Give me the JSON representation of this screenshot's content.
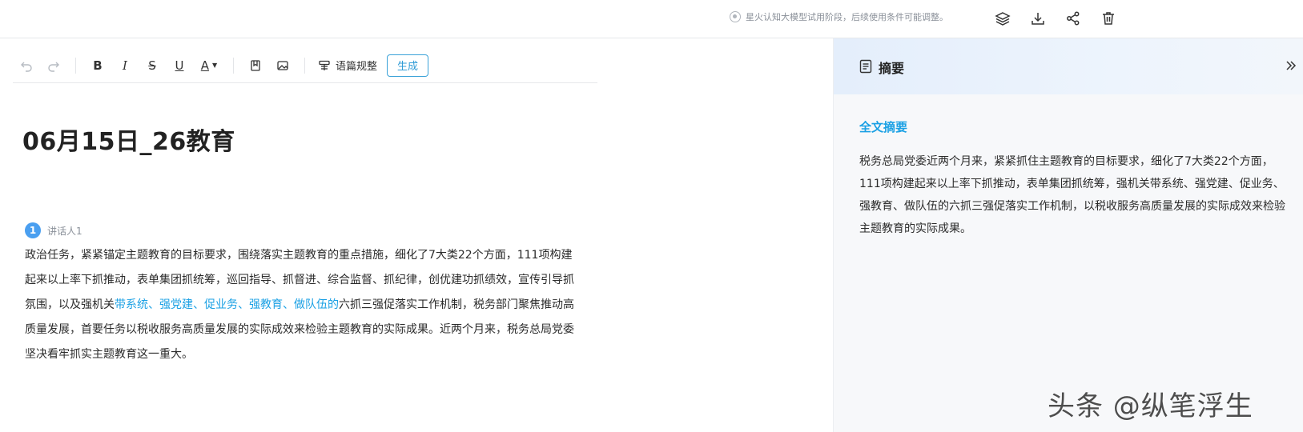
{
  "topbar": {
    "notice": "星火认知大模型试用阶段，后续使用条件可能调整。",
    "actions": [
      "layers-icon",
      "download-icon",
      "share-icon",
      "trash-icon"
    ]
  },
  "toolbar": {
    "undo": "↶",
    "redo": "↷",
    "bold": "B",
    "italic": "I",
    "strike": "S",
    "underline": "U",
    "font_color": "A",
    "polish_label": "语篇规整",
    "generate_label": "生成"
  },
  "document": {
    "title": "06月15日_26教育",
    "speaker_number": "1",
    "speaker_name": "讲话人1",
    "text_before": "政治任务，紧紧锚定主题教育的目标要求，围绕落实主题教育的重点措施，细化了7大类22个方面，111项构建起来以上率下抓推动，表单集团抓统筹，巡回指导、抓督进、综合监督、抓纪律，创优建功抓绩效，宣传引导抓氛围，以及强机关",
    "text_highlight": "带系统、强党建、促业务、强教育、做队伍的",
    "text_after": "六抓三强促落实工作机制，税务部门聚焦推动高质量发展，首要任务以税收服务高质量发展的实际成效来检验主题教育的实际成果。近两个月来，税务总局党委坚决看牢抓实主题教育这一重大。"
  },
  "summary": {
    "title": "摘要",
    "heading": "全文摘要",
    "text": "税务总局党委近两个月来，紧紧抓住主题教育的目标要求，细化了7大类22个方面，111项构建起来以上率下抓推动，表单集团抓统筹，强机关带系统、强党建、促业务、强教育、做队伍的六抓三强促落实工作机制，以税收服务高质量发展的实际成效来检验主题教育的实际成果。"
  },
  "watermark": "头条 @纵笔浮生",
  "colors": {
    "accent": "#1aa0e4",
    "speaker_badge": "#4a9ff0"
  }
}
